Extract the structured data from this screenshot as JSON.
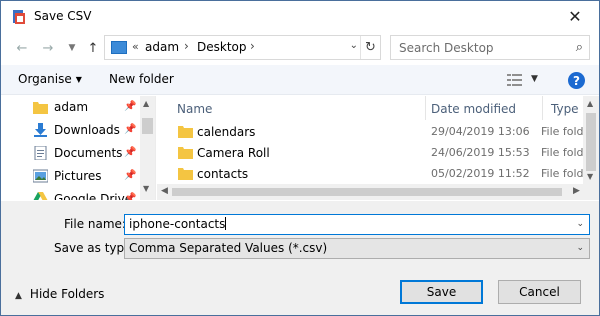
{
  "window": {
    "title": "Save CSV"
  },
  "address": {
    "overflow": "«",
    "crumbs": [
      "adam",
      "Desktop"
    ]
  },
  "search": {
    "placeholder": "Search Desktop"
  },
  "toolbar": {
    "organise_label": "Organise",
    "new_folder_label": "New folder",
    "help_label": "?"
  },
  "nav_pane": {
    "items": [
      {
        "label": "adam",
        "icon": "folder-icon",
        "pinned": true
      },
      {
        "label": "Downloads",
        "icon": "download-icon",
        "pinned": true
      },
      {
        "label": "Documents",
        "icon": "documents-icon",
        "pinned": true
      },
      {
        "label": "Pictures",
        "icon": "pictures-icon",
        "pinned": true
      },
      {
        "label": "Google Drive",
        "icon": "google-drive-icon",
        "pinned": true
      }
    ]
  },
  "file_list": {
    "columns": [
      "Name",
      "Date modified",
      "Type"
    ],
    "rows": [
      {
        "name": "calendars",
        "date": "29/04/2019 13:06",
        "type": "File folder"
      },
      {
        "name": "Camera Roll",
        "date": "24/06/2019 15:53",
        "type": "File folder"
      },
      {
        "name": "contacts",
        "date": "05/02/2019 11:52",
        "type": "File folder"
      }
    ]
  },
  "form": {
    "file_name_label": "File name:",
    "file_name_value": "iphone-contacts",
    "save_type_label": "Save as type:",
    "save_type_value": "Comma Separated Values (*.csv)"
  },
  "footer": {
    "hide_folders_label": "Hide Folders",
    "save_label": "Save",
    "cancel_label": "Cancel"
  },
  "colors": {
    "accent": "#0078d7",
    "folder": "#f4c542",
    "help": "#1c6ad1"
  }
}
